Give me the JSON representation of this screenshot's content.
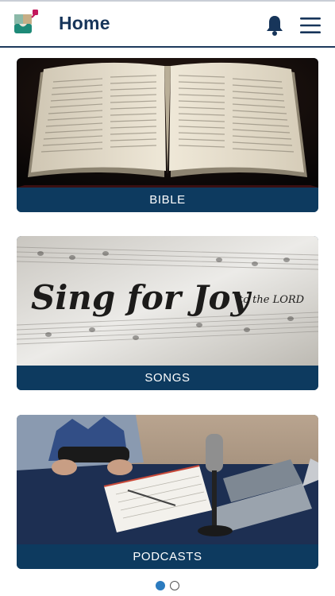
{
  "header": {
    "title": "Home"
  },
  "cards": [
    {
      "label": "BIBLE"
    },
    {
      "label": "SONGS",
      "image_text": {
        "main": "Sing for Joy",
        "sub": "to the LORD"
      }
    },
    {
      "label": "PODCASTS"
    }
  ],
  "pagination": {
    "active_index": 0,
    "count": 2
  },
  "colors": {
    "brand_navy": "#0d3a5f",
    "title": "#17355a",
    "dot_active": "#2b7bbf"
  }
}
